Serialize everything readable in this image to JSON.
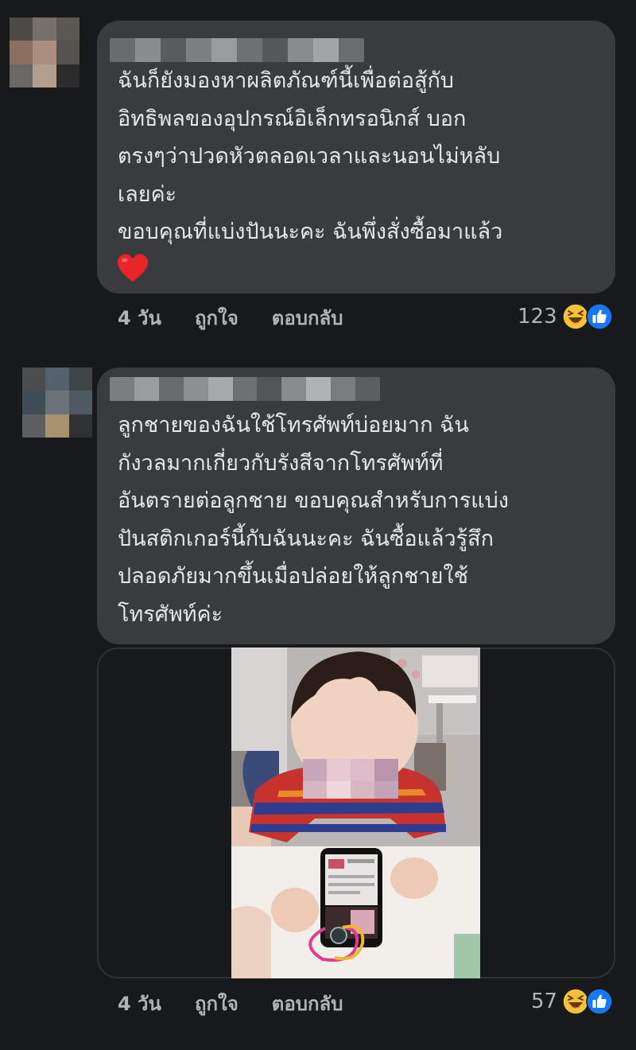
{
  "comments": [
    {
      "text_lines": [
        "ฉันก็ยังมองหาผลิตภัณฑ์นี้เพื่อต่อสู้กับ",
        "อิทธิพลของอุปกรณ์อิเล็กทรอนิกส์ บอก",
        "ตรงๆว่าปวดหัวตลอดเวลาและนอนไม่หลับ",
        "เลยค่ะ",
        "ขอบคุณที่แบ่งปันนะคะ ฉันพึ่งสั่งซื้อมาแล้ว"
      ],
      "emoji": "heart-emoji",
      "time": "4 วัน",
      "like_label": "ถูกใจ",
      "reply_label": "ตอบกลับ",
      "reaction_count": "123",
      "reactions": [
        "haha-emoji",
        "like-emoji"
      ]
    },
    {
      "text_lines": [
        "ลูกชายของฉันใช้โทรศัพท์บ่อยมาก ฉัน",
        "กังวลมากเกี่ยวกับรังสีจากโทรศัพท์ที่",
        "อันตรายต่อลูกชาย ขอบคุณสำหรับการแบ่ง",
        "ปันสติกเกอร์นี้กับฉันนะคะ ฉันซื้อแล้วรู้สึก",
        "ปลอดภัยมากขึ้นเมื่อปล่อยให้ลูกชายใช้",
        "โทรศัพท์ค่ะ"
      ],
      "time": "4 วัน",
      "like_label": "ถูกใจ",
      "reply_label": "ตอบกลับ",
      "reaction_count": "57",
      "reactions": [
        "haha-emoji",
        "like-emoji"
      ]
    }
  ],
  "colors": {
    "background": "#18191a",
    "bubble": "#3a3b3c",
    "text": "#e4e6eb",
    "meta_text": "#b0b3b8",
    "like_blue": "#1877f2",
    "haha_yellow": "#f7c137",
    "heart_red": "#e8242b"
  }
}
